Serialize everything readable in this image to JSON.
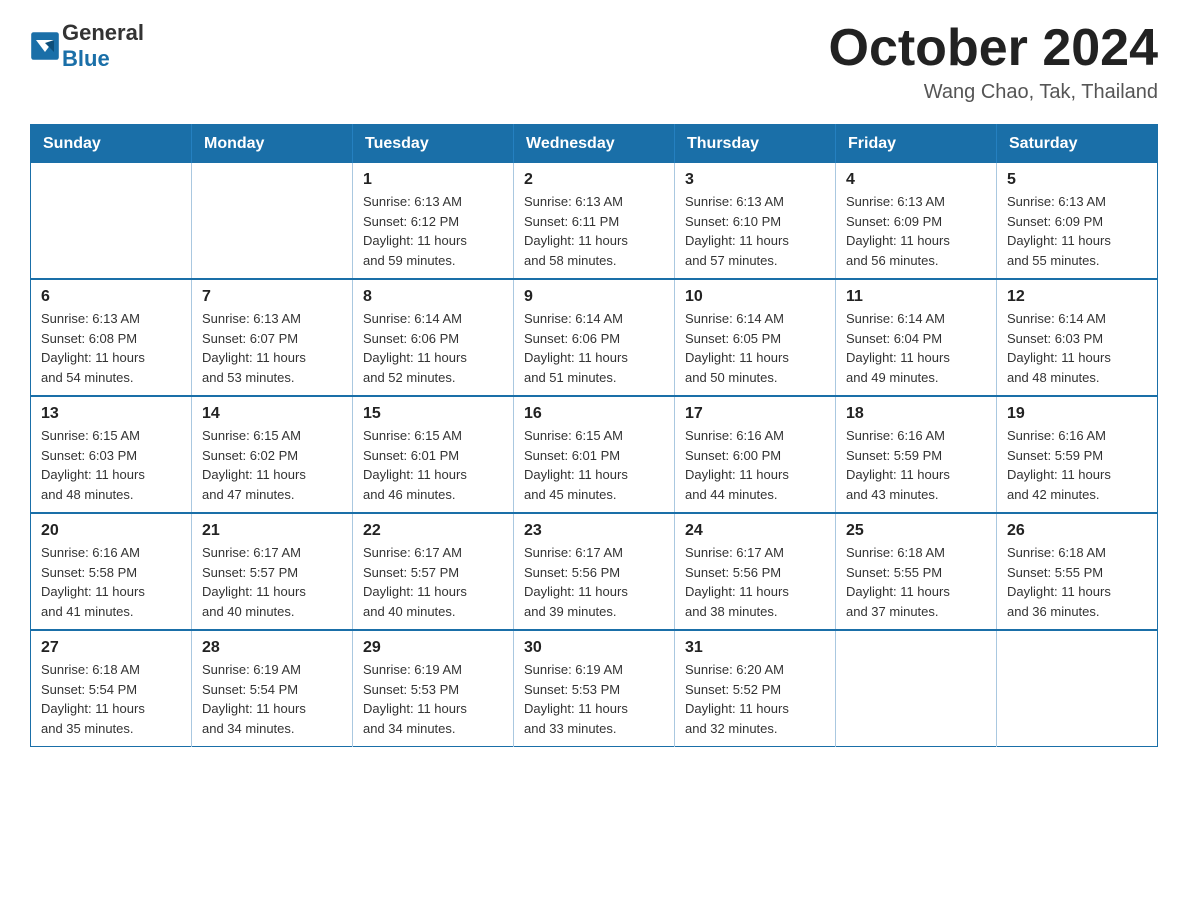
{
  "header": {
    "logo_line1": "General",
    "logo_line2": "Blue",
    "month_title": "October 2024",
    "location": "Wang Chao, Tak, Thailand"
  },
  "weekdays": [
    "Sunday",
    "Monday",
    "Tuesday",
    "Wednesday",
    "Thursday",
    "Friday",
    "Saturday"
  ],
  "weeks": [
    [
      {
        "day": "",
        "info": ""
      },
      {
        "day": "",
        "info": ""
      },
      {
        "day": "1",
        "info": "Sunrise: 6:13 AM\nSunset: 6:12 PM\nDaylight: 11 hours\nand 59 minutes."
      },
      {
        "day": "2",
        "info": "Sunrise: 6:13 AM\nSunset: 6:11 PM\nDaylight: 11 hours\nand 58 minutes."
      },
      {
        "day": "3",
        "info": "Sunrise: 6:13 AM\nSunset: 6:10 PM\nDaylight: 11 hours\nand 57 minutes."
      },
      {
        "day": "4",
        "info": "Sunrise: 6:13 AM\nSunset: 6:09 PM\nDaylight: 11 hours\nand 56 minutes."
      },
      {
        "day": "5",
        "info": "Sunrise: 6:13 AM\nSunset: 6:09 PM\nDaylight: 11 hours\nand 55 minutes."
      }
    ],
    [
      {
        "day": "6",
        "info": "Sunrise: 6:13 AM\nSunset: 6:08 PM\nDaylight: 11 hours\nand 54 minutes."
      },
      {
        "day": "7",
        "info": "Sunrise: 6:13 AM\nSunset: 6:07 PM\nDaylight: 11 hours\nand 53 minutes."
      },
      {
        "day": "8",
        "info": "Sunrise: 6:14 AM\nSunset: 6:06 PM\nDaylight: 11 hours\nand 52 minutes."
      },
      {
        "day": "9",
        "info": "Sunrise: 6:14 AM\nSunset: 6:06 PM\nDaylight: 11 hours\nand 51 minutes."
      },
      {
        "day": "10",
        "info": "Sunrise: 6:14 AM\nSunset: 6:05 PM\nDaylight: 11 hours\nand 50 minutes."
      },
      {
        "day": "11",
        "info": "Sunrise: 6:14 AM\nSunset: 6:04 PM\nDaylight: 11 hours\nand 49 minutes."
      },
      {
        "day": "12",
        "info": "Sunrise: 6:14 AM\nSunset: 6:03 PM\nDaylight: 11 hours\nand 48 minutes."
      }
    ],
    [
      {
        "day": "13",
        "info": "Sunrise: 6:15 AM\nSunset: 6:03 PM\nDaylight: 11 hours\nand 48 minutes."
      },
      {
        "day": "14",
        "info": "Sunrise: 6:15 AM\nSunset: 6:02 PM\nDaylight: 11 hours\nand 47 minutes."
      },
      {
        "day": "15",
        "info": "Sunrise: 6:15 AM\nSunset: 6:01 PM\nDaylight: 11 hours\nand 46 minutes."
      },
      {
        "day": "16",
        "info": "Sunrise: 6:15 AM\nSunset: 6:01 PM\nDaylight: 11 hours\nand 45 minutes."
      },
      {
        "day": "17",
        "info": "Sunrise: 6:16 AM\nSunset: 6:00 PM\nDaylight: 11 hours\nand 44 minutes."
      },
      {
        "day": "18",
        "info": "Sunrise: 6:16 AM\nSunset: 5:59 PM\nDaylight: 11 hours\nand 43 minutes."
      },
      {
        "day": "19",
        "info": "Sunrise: 6:16 AM\nSunset: 5:59 PM\nDaylight: 11 hours\nand 42 minutes."
      }
    ],
    [
      {
        "day": "20",
        "info": "Sunrise: 6:16 AM\nSunset: 5:58 PM\nDaylight: 11 hours\nand 41 minutes."
      },
      {
        "day": "21",
        "info": "Sunrise: 6:17 AM\nSunset: 5:57 PM\nDaylight: 11 hours\nand 40 minutes."
      },
      {
        "day": "22",
        "info": "Sunrise: 6:17 AM\nSunset: 5:57 PM\nDaylight: 11 hours\nand 40 minutes."
      },
      {
        "day": "23",
        "info": "Sunrise: 6:17 AM\nSunset: 5:56 PM\nDaylight: 11 hours\nand 39 minutes."
      },
      {
        "day": "24",
        "info": "Sunrise: 6:17 AM\nSunset: 5:56 PM\nDaylight: 11 hours\nand 38 minutes."
      },
      {
        "day": "25",
        "info": "Sunrise: 6:18 AM\nSunset: 5:55 PM\nDaylight: 11 hours\nand 37 minutes."
      },
      {
        "day": "26",
        "info": "Sunrise: 6:18 AM\nSunset: 5:55 PM\nDaylight: 11 hours\nand 36 minutes."
      }
    ],
    [
      {
        "day": "27",
        "info": "Sunrise: 6:18 AM\nSunset: 5:54 PM\nDaylight: 11 hours\nand 35 minutes."
      },
      {
        "day": "28",
        "info": "Sunrise: 6:19 AM\nSunset: 5:54 PM\nDaylight: 11 hours\nand 34 minutes."
      },
      {
        "day": "29",
        "info": "Sunrise: 6:19 AM\nSunset: 5:53 PM\nDaylight: 11 hours\nand 34 minutes."
      },
      {
        "day": "30",
        "info": "Sunrise: 6:19 AM\nSunset: 5:53 PM\nDaylight: 11 hours\nand 33 minutes."
      },
      {
        "day": "31",
        "info": "Sunrise: 6:20 AM\nSunset: 5:52 PM\nDaylight: 11 hours\nand 32 minutes."
      },
      {
        "day": "",
        "info": ""
      },
      {
        "day": "",
        "info": ""
      }
    ]
  ]
}
